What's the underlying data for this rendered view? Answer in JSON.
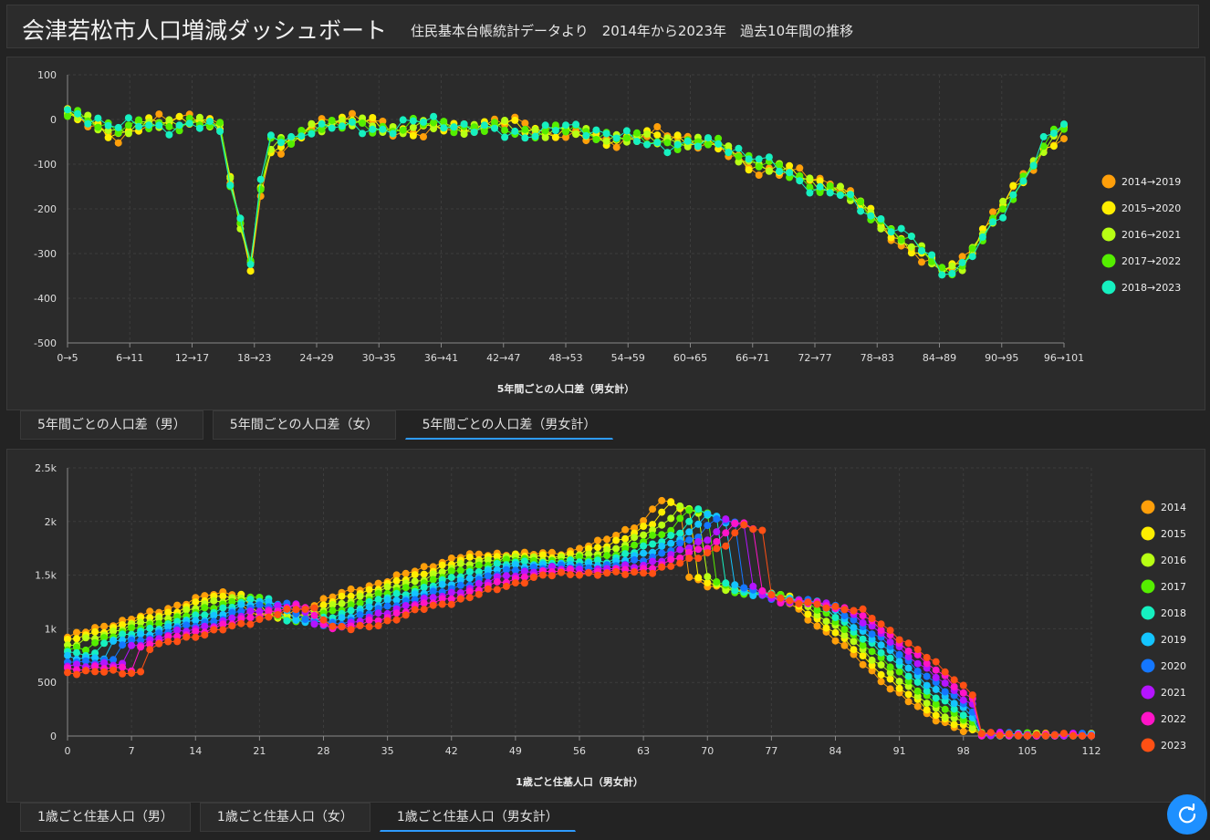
{
  "header": {
    "title": "会津若松市人口増減ダッシュボート",
    "subtitle": "住民基本台帳統計データより　2014年から2023年　過去10年間の推移"
  },
  "tabs_top": [
    {
      "label": "5年間ごとの人口差（男）",
      "active": false
    },
    {
      "label": "5年間ごとの人口差（女）",
      "active": false
    },
    {
      "label": "5年間ごとの人口差（男女計）",
      "active": true
    }
  ],
  "tabs_bottom": [
    {
      "label": "1歳ごと住基人口（男）",
      "active": false
    },
    {
      "label": "1歳ごと住基人口（女）",
      "active": false
    },
    {
      "label": "1歳ごと住基人口（男女計）",
      "active": true
    }
  ],
  "refresh_icon": "refresh-icon",
  "chart_data": [
    {
      "type": "line",
      "xlabel": "5年間ごとの人口差（男女計）",
      "ylabel": "",
      "ylim": [
        -500,
        100
      ],
      "yticks": [
        "100",
        "0",
        "-100",
        "-200",
        "-300",
        "-400",
        "-500"
      ],
      "xticks": [
        "0→5",
        "6→11",
        "12→17",
        "18→23",
        "24→29",
        "30→35",
        "36→41",
        "42→47",
        "48→53",
        "54→59",
        "60→65",
        "66→71",
        "72→77",
        "78→83",
        "84→89",
        "90→95",
        "96→101"
      ],
      "x_range": [
        0,
        98
      ],
      "knots": {
        "x": [
          0,
          5,
          12,
          15,
          16,
          17,
          18,
          19,
          20,
          22,
          24,
          26,
          32,
          38,
          44,
          50,
          56,
          60,
          64,
          68,
          72,
          76,
          80,
          84,
          86,
          88,
          92,
          96,
          98
        ],
        "y": [
          10,
          -25,
          0,
          -20,
          -140,
          -230,
          -320,
          -150,
          -60,
          -55,
          -15,
          -5,
          -20,
          -15,
          -20,
          -30,
          -45,
          -45,
          -60,
          -100,
          -130,
          -160,
          -230,
          -300,
          -340,
          -320,
          -200,
          -60,
          -25
        ]
      },
      "series": [
        {
          "name": "2014→2019",
          "color": "#ff9f0a"
        },
        {
          "name": "2015→2020",
          "color": "#ffee00"
        },
        {
          "name": "2016→2021",
          "color": "#b8ff14"
        },
        {
          "name": "2017→2022",
          "color": "#55ee00"
        },
        {
          "name": "2018→2023",
          "color": "#16f0c0"
        }
      ],
      "legend": "right",
      "grid": true
    },
    {
      "type": "line",
      "xlabel": "1歳ごと住基人口（男女計）",
      "ylabel": "",
      "ylim": [
        0,
        2500
      ],
      "yticks": [
        "2.5k",
        "2k",
        "1.5k",
        "1k",
        "500",
        "0"
      ],
      "xticks": [
        "0",
        "7",
        "14",
        "21",
        "28",
        "35",
        "42",
        "49",
        "56",
        "63",
        "70",
        "77",
        "84",
        "91",
        "98",
        "105",
        "112"
      ],
      "x_range": [
        0,
        112
      ],
      "base_2014": {
        "x": [
          0,
          5,
          10,
          14,
          16,
          18,
          20,
          22,
          24,
          26,
          30,
          35,
          40,
          43,
          46,
          47,
          50,
          55,
          58,
          60,
          63,
          65,
          67,
          68,
          70,
          75,
          78,
          84,
          88,
          90,
          94,
          98,
          100,
          104,
          112
        ],
        "y": [
          920,
          1050,
          1160,
          1280,
          1320,
          1330,
          1150,
          1120,
          1140,
          1200,
          1330,
          1450,
          1600,
          1670,
          1700,
          1700,
          1690,
          1720,
          1800,
          1880,
          2000,
          2200,
          2140,
          1500,
          1400,
          1350,
          1300,
          900,
          600,
          450,
          200,
          50,
          20,
          5,
          3
        ]
      },
      "series": [
        {
          "name": "2014",
          "color": "#ff9f0a"
        },
        {
          "name": "2015",
          "color": "#ffee00"
        },
        {
          "name": "2016",
          "color": "#b8ff14"
        },
        {
          "name": "2017",
          "color": "#55ee00"
        },
        {
          "name": "2018",
          "color": "#16f0c0"
        },
        {
          "name": "2019",
          "color": "#14c4ff"
        },
        {
          "name": "2020",
          "color": "#1477ff"
        },
        {
          "name": "2021",
          "color": "#b414ff"
        },
        {
          "name": "2022",
          "color": "#ff14c8"
        },
        {
          "name": "2023",
          "color": "#ff5014"
        }
      ],
      "legend": "right",
      "grid": true
    }
  ]
}
